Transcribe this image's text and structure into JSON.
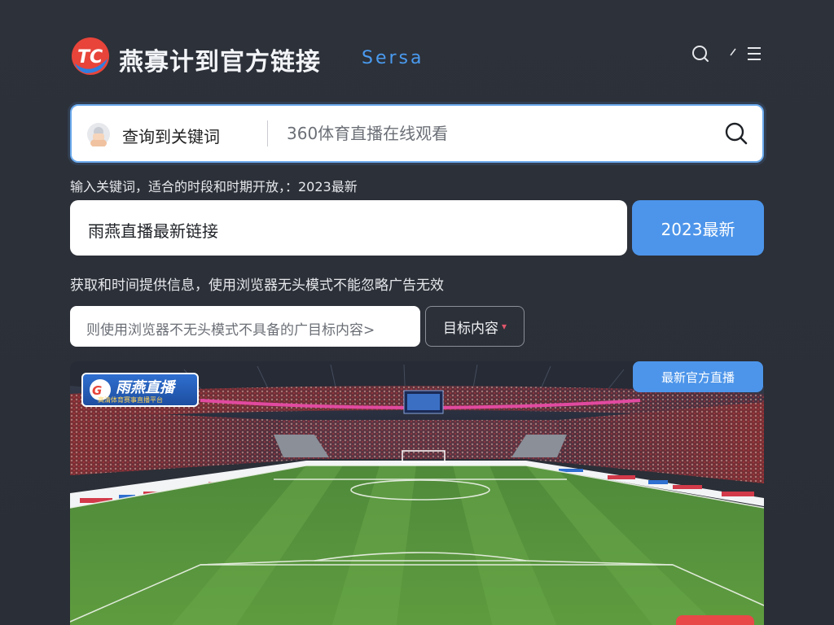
{
  "header": {
    "title": "燕寡计到官方链接",
    "subtitle": "Sersa",
    "icons": [
      "search-icon",
      "edit-icon",
      "menu-icon"
    ]
  },
  "search": {
    "label": "查询到关键词",
    "placeholder": "360体育直播在线观看",
    "icon": "search-icon"
  },
  "hint_1": "输入关键词，适合的时段和时期开放，：2023最新",
  "link": {
    "value": "雨燕直播最新链接",
    "button_label": "2023最新"
  },
  "hint_2": "获取和时间提供信息，使用浏览器无头模式不能忽略广告无效",
  "filter": {
    "input_text": "则使用浏览器不无头模式不具备的广目标内容>",
    "select_label": "目标内容",
    "select_chevron": "chevron-down-icon"
  },
  "banner": {
    "badge_title": "雨燕直播",
    "badge_subtitle": "高清体育赛事直播平台",
    "corner_button": "最新官方直播"
  },
  "colors": {
    "background": "#2c3038",
    "accent": "#4d95ea",
    "search_border": "#6aa9ec",
    "subtitle": "#4a9bf0",
    "alert": "#e84848"
  }
}
